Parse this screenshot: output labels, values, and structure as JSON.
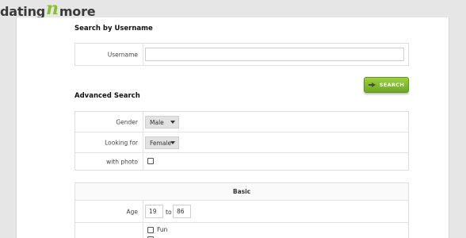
{
  "logo": {
    "part1": "dating",
    "part2": "n",
    "part3": "more"
  },
  "username_section": {
    "title": "Search by Username",
    "label": "Username",
    "value": "",
    "placeholder": ""
  },
  "search_button": {
    "label": "SEARCH"
  },
  "advanced": {
    "title": "Advanced Search",
    "gender": {
      "label": "Gender",
      "selected": "Male"
    },
    "looking_for": {
      "label": "Looking for",
      "selected": "Female"
    },
    "with_photo": {
      "label": "with photo"
    }
  },
  "basic": {
    "title": "Basic",
    "age": {
      "label": "Age",
      "from": "19",
      "sep": "to",
      "to": "86"
    },
    "options": [
      {
        "label": "Fun"
      }
    ]
  }
}
